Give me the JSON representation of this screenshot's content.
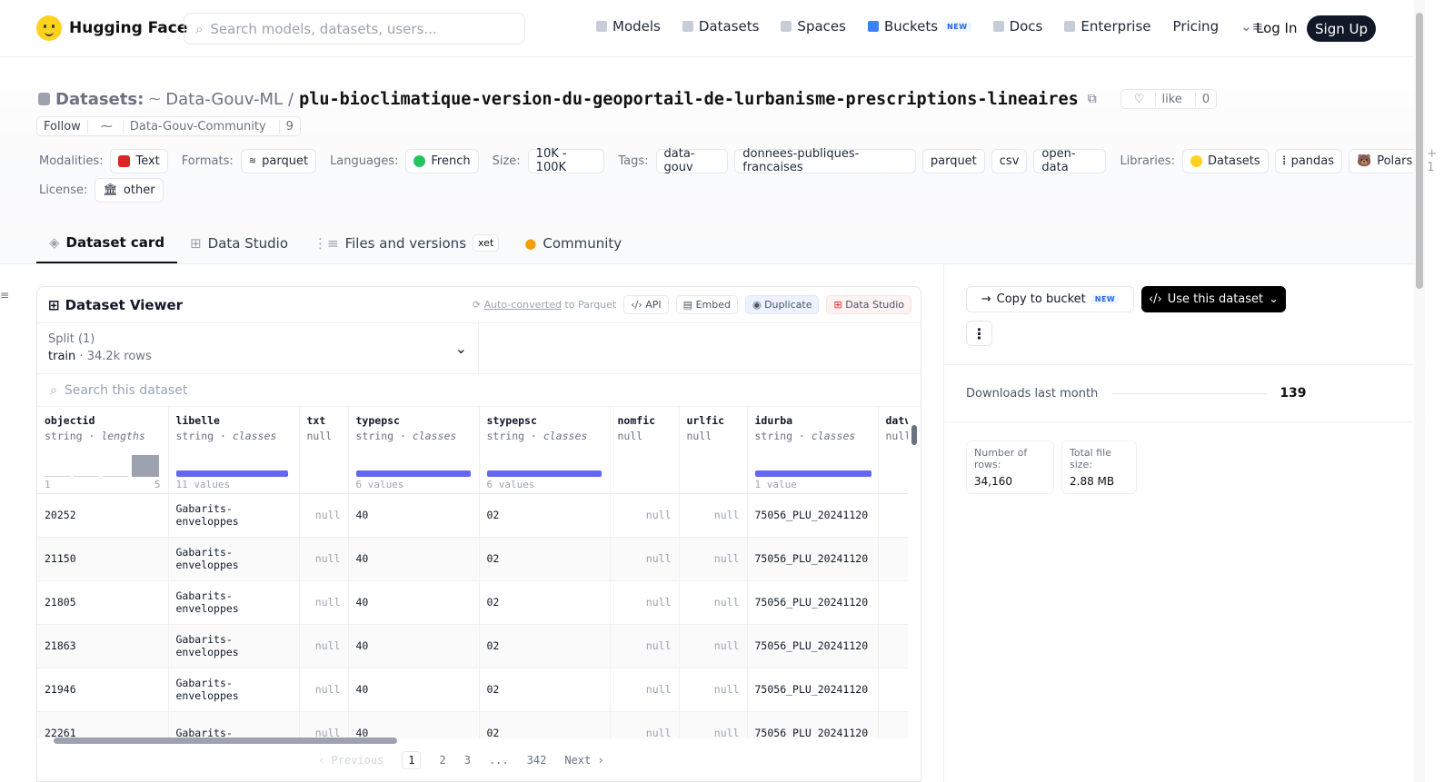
{
  "nav": {
    "brand": "Hugging Face",
    "search_placeholder": "Search models, datasets, users...",
    "links": [
      {
        "label": "Models"
      },
      {
        "label": "Datasets"
      },
      {
        "label": "Spaces"
      },
      {
        "label": "Buckets",
        "badge": "NEW"
      },
      {
        "label": "Docs"
      },
      {
        "label": "Enterprise"
      },
      {
        "label": "Pricing"
      }
    ],
    "login": "Log In",
    "signup": "Sign Up"
  },
  "header": {
    "prefix": "Datasets:",
    "owner": "Data-Gouv-ML",
    "separator": "/",
    "name": "plu-bioclimatique-version-du-geoportail-de-lurbanisme-prescriptions-lineaires",
    "like": "like",
    "like_count": "0",
    "follow": "Follow",
    "follow_org": "Data-Gouv-Community",
    "follow_count": "9"
  },
  "meta": {
    "modalities_label": "Modalities:",
    "modality": "Text",
    "formats_label": "Formats:",
    "format": "parquet",
    "languages_label": "Languages:",
    "language": "French",
    "size_label": "Size:",
    "size": "10K - 100K",
    "tags_label": "Tags:",
    "tags": [
      "data-gouv",
      "donnees-publiques-francaises",
      "parquet",
      "csv",
      "open-data"
    ],
    "libraries_label": "Libraries:",
    "libraries": [
      "Datasets",
      "pandas",
      "Polars"
    ],
    "libraries_more": "+ 1",
    "license_label": "License:",
    "license": "other"
  },
  "tabs": [
    {
      "label": "Dataset card"
    },
    {
      "label": "Data Studio"
    },
    {
      "label": "Files and versions",
      "badge": "xet"
    },
    {
      "label": "Community"
    }
  ],
  "viewer": {
    "title": "Dataset Viewer",
    "auto": "Auto-converted",
    "auto_suffix": "to Parquet",
    "api": "API",
    "embed": "Embed",
    "duplicate": "Duplicate",
    "data_studio": "Data Studio",
    "split_label": "Split (1)",
    "split_name": "train",
    "split_rows": "34.2k rows",
    "search_placeholder": "Search this dataset",
    "columns": [
      {
        "name": "objectid",
        "type": "string",
        "sub": "lengths",
        "hist_min": "1",
        "hist_max": "5"
      },
      {
        "name": "libelle",
        "type": "string",
        "sub": "classes",
        "count": "11 values"
      },
      {
        "name": "txt",
        "type": "null"
      },
      {
        "name": "typepsc",
        "type": "string",
        "sub": "classes",
        "count": "6 values"
      },
      {
        "name": "stypepsc",
        "type": "string",
        "sub": "classes",
        "count": "6 values"
      },
      {
        "name": "nomfic",
        "type": "null"
      },
      {
        "name": "urlfic",
        "type": "null"
      },
      {
        "name": "idurba",
        "type": "string",
        "sub": "classes",
        "count": "1 value"
      },
      {
        "name": "datv",
        "type": "null"
      }
    ],
    "rows": [
      [
        "20252",
        "Gabarits-\nenveloppes",
        "null",
        "40",
        "02",
        "null",
        "null",
        "75056_PLU_20241120"
      ],
      [
        "21150",
        "Gabarits-\nenveloppes",
        "null",
        "40",
        "02",
        "null",
        "null",
        "75056_PLU_20241120"
      ],
      [
        "21805",
        "Gabarits-\nenveloppes",
        "null",
        "40",
        "02",
        "null",
        "null",
        "75056_PLU_20241120"
      ],
      [
        "21863",
        "Gabarits-\nenveloppes",
        "null",
        "40",
        "02",
        "null",
        "null",
        "75056_PLU_20241120"
      ],
      [
        "21946",
        "Gabarits-\nenveloppes",
        "null",
        "40",
        "02",
        "null",
        "null",
        "75056_PLU_20241120"
      ],
      [
        "22261",
        "Gabarits-",
        "null",
        "40",
        "02",
        "null",
        "null",
        "75056_PLU_20241120"
      ]
    ],
    "pager": {
      "prev": "‹ Previous",
      "pages": [
        "1",
        "2",
        "3",
        "...",
        "342"
      ],
      "next": "Next ›"
    }
  },
  "sidebar": {
    "copy": "Copy to bucket",
    "copy_badge": "NEW",
    "use": "Use this dataset",
    "downloads_label": "Downloads last month",
    "downloads": "139",
    "rows_label": "Number of rows:",
    "rows": "34,160",
    "size_label": "Total file size:",
    "size": "2.88 MB"
  }
}
